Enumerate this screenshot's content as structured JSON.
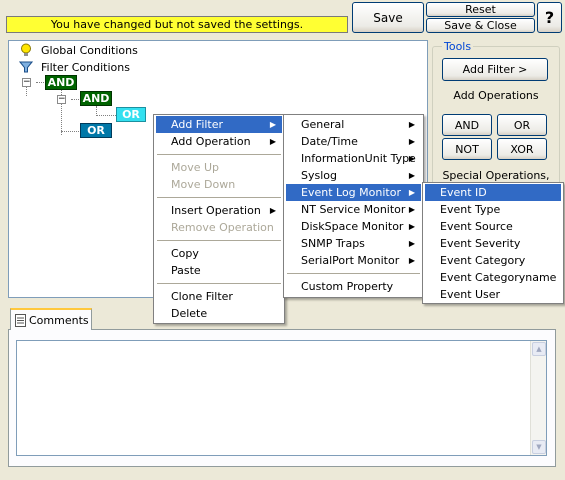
{
  "notice": "You have changed but not saved the settings.",
  "buttons": {
    "save": "Save",
    "reset": "Reset",
    "save_close": "Save & Close",
    "help": "?"
  },
  "tree": {
    "global_conditions": "Global Conditions",
    "filter_conditions": "Filter Conditions",
    "nodes": {
      "and_root": "AND",
      "and_child": "AND",
      "or_child": "OR",
      "or_sibling": "OR"
    },
    "expander": "−"
  },
  "tools": {
    "legend": "Tools",
    "add_filter": "Add Filter >",
    "add_operations": "Add Operations",
    "ops": [
      "AND",
      "OR",
      "NOT",
      "XOR"
    ],
    "special": "Special Operations,"
  },
  "comments": {
    "tab": "Comments",
    "text": ""
  },
  "context_menu": {
    "items": [
      {
        "label": "Add Filter",
        "submenu": true,
        "selected": true
      },
      {
        "label": "Add Operation",
        "submenu": true
      },
      {
        "label": "Move Up",
        "disabled": true
      },
      {
        "label": "Move Down",
        "disabled": true
      },
      {
        "label": "Insert Operation",
        "submenu": true
      },
      {
        "label": "Remove Operation",
        "disabled": true
      },
      {
        "label": "Copy"
      },
      {
        "label": "Paste"
      },
      {
        "label": "Clone Filter"
      },
      {
        "label": "Delete"
      }
    ]
  },
  "filter_submenu": {
    "items": [
      {
        "label": "General"
      },
      {
        "label": "Date/Time"
      },
      {
        "label": "InformationUnit Type"
      },
      {
        "label": "Syslog"
      },
      {
        "label": "Event Log Monitor",
        "selected": true
      },
      {
        "label": "NT Service Monitor"
      },
      {
        "label": "DiskSpace Monitor"
      },
      {
        "label": "SNMP Traps"
      },
      {
        "label": "SerialPort Monitor"
      },
      {
        "label": "Custom Property"
      }
    ]
  },
  "eventlog_submenu": {
    "items": [
      {
        "label": "Event ID",
        "selected": true
      },
      {
        "label": "Event Type"
      },
      {
        "label": "Event Source"
      },
      {
        "label": "Event Severity"
      },
      {
        "label": "Event Category"
      },
      {
        "label": "Event Categoryname"
      },
      {
        "label": "Event User"
      }
    ]
  },
  "colors": {
    "highlight": "#316ac5",
    "notice_bg": "#ffff33",
    "and_node": "#006400",
    "or_node": "#0078a8"
  }
}
